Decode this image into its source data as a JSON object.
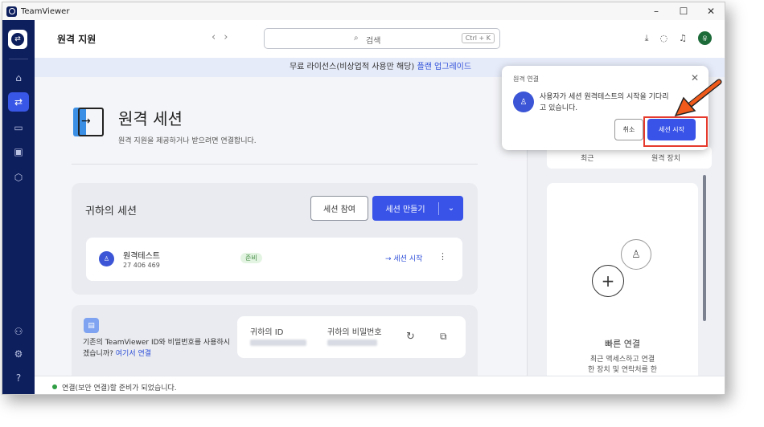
{
  "window": {
    "app_title": "TeamViewer",
    "minimize": "–",
    "maximize": "☐",
    "close": "✕"
  },
  "header": {
    "page_title": "원격 지원",
    "nav_back": "‹",
    "nav_forward": "›",
    "search_placeholder": "검색",
    "search_shortcut": "Ctrl + K"
  },
  "avatar_initials": "유",
  "banner": {
    "text": "무료 라이선스(비상업적 사용만 해당)",
    "upgrade_link": "플랜 업그레이드"
  },
  "remote_session": {
    "title": "원격 세션",
    "subtitle": "원격 지원을 제공하거나 받으려면 연결합니다."
  },
  "my_sessions": {
    "title": "귀하의 세션",
    "join_button": "세션 참여",
    "create_button": "세션 만들기",
    "session": {
      "name": "원격테스트",
      "id": "27 406 469",
      "status": "준비",
      "start_link": "세션 시작",
      "more": "⋮"
    }
  },
  "credentials": {
    "text": "기존의 TeamViewer ID와 비밀번호를 사용하시겠습니까?",
    "link": "여기서 연결",
    "id_label": "귀하의 ID",
    "password_label": "귀하의 비밀번호"
  },
  "right_panel": {
    "tab_recent": "최근",
    "tab_devices": "원격 장치",
    "quick_connect_title": "빠른 연결",
    "quick_connect_desc_1": "최근 액세스하고 연결",
    "quick_connect_desc_2": "한 장치 및 연락처를 한"
  },
  "popup": {
    "title": "원격 연결",
    "message_line1": "사용자가 세션 원격테스트의 시작을 기다리",
    "message_line2": "고 있습니다.",
    "cancel": "취소",
    "start": "세션 시작"
  },
  "status_bar": {
    "text": "연결(보안 연결)할 준비가 되었습니다."
  },
  "colors": {
    "sidebar": "#0e1f5e",
    "accent": "#3953e8",
    "highlight": "#e53a2d",
    "arrow": "#f05a1a"
  }
}
